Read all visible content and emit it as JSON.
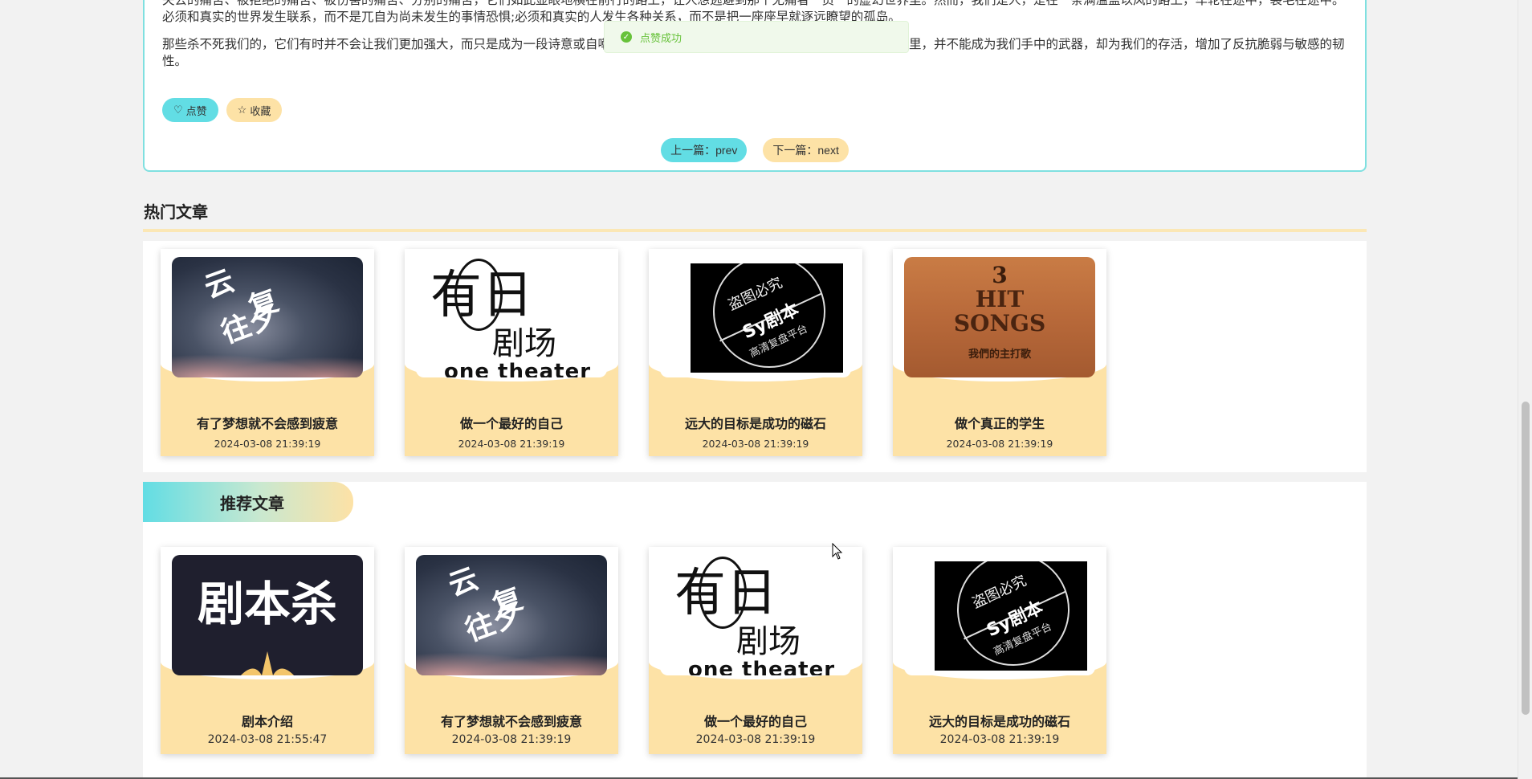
{
  "article": {
    "para1": "失去的痛苦、被拒绝的痛苦、被伤害的痛苦、分别的痛苦，它们如此显眼地横在前行的路上，让人想逃避到那个无痛者一员一的虚幻世界里。然而，我们是人，是在一条满溢盖以风的路上，车轮在途中，裂毛在途中。必须和真实的世界发生联系，而不是兀自为尚未发生的事情恐惧;必须和真实的人发生各种关系，而不是把一座座早就逐远瞭望的孤岛。",
    "para2": "那些杀不死我们的，它们有时并不会让我们更加强大，而只是成为一段诗意或自嘲的见证。那些杀不死我们的，它们在混沌而无序的末来里，并不能成为我们手中的武器，却为我们的存活，增加了反抗脆弱与敏感的韧性。",
    "like_label": "点赞",
    "fav_label": "收藏",
    "prev_label": "上一篇：prev",
    "next_label": "下一篇：next"
  },
  "toast": {
    "text": "点赞成功"
  },
  "hot": {
    "title": "热门文章",
    "cards": [
      {
        "title": "有了梦想就不会感到疲意",
        "date": "2024-03-08 21:39:19"
      },
      {
        "title": "做一个最好的自己",
        "date": "2024-03-08 21:39:19"
      },
      {
        "title": "远大的目标是成功的磁石",
        "date": "2024-03-08 21:39:19"
      },
      {
        "title": "做个真正的学生",
        "date": "2024-03-08 21:39:19"
      }
    ]
  },
  "recommend": {
    "title": "推荐文章",
    "cards": [
      {
        "title": "剧本介绍",
        "date": "2024-03-08 21:55:47"
      },
      {
        "title": "有了梦想就不会感到疲意",
        "date": "2024-03-08 21:39:19"
      },
      {
        "title": "做一个最好的自己",
        "date": "2024-03-08 21:39:19"
      },
      {
        "title": "远大的目标是成功的磁石",
        "date": "2024-03-08 21:39:19"
      }
    ]
  },
  "thumbs": {
    "cloud": {
      "c1": "云",
      "c2": "复",
      "c3": "往夕"
    },
    "theater": {
      "big": "有日",
      "mid": "剧场",
      "eng": "one theater"
    },
    "watermark": {
      "t1": "盗图必究",
      "t2": "Sy剧本",
      "t3": "高清复盘平台"
    },
    "wood": {
      "n": "3",
      "h": "HIT",
      "s": "SONGS",
      "sub": "我們的主打歌"
    },
    "jbs": {
      "t": "剧本杀"
    }
  },
  "colors": {
    "accent_cyan": "#62dde4",
    "accent_gold": "#fde2a6",
    "success_green": "#67c23a"
  }
}
